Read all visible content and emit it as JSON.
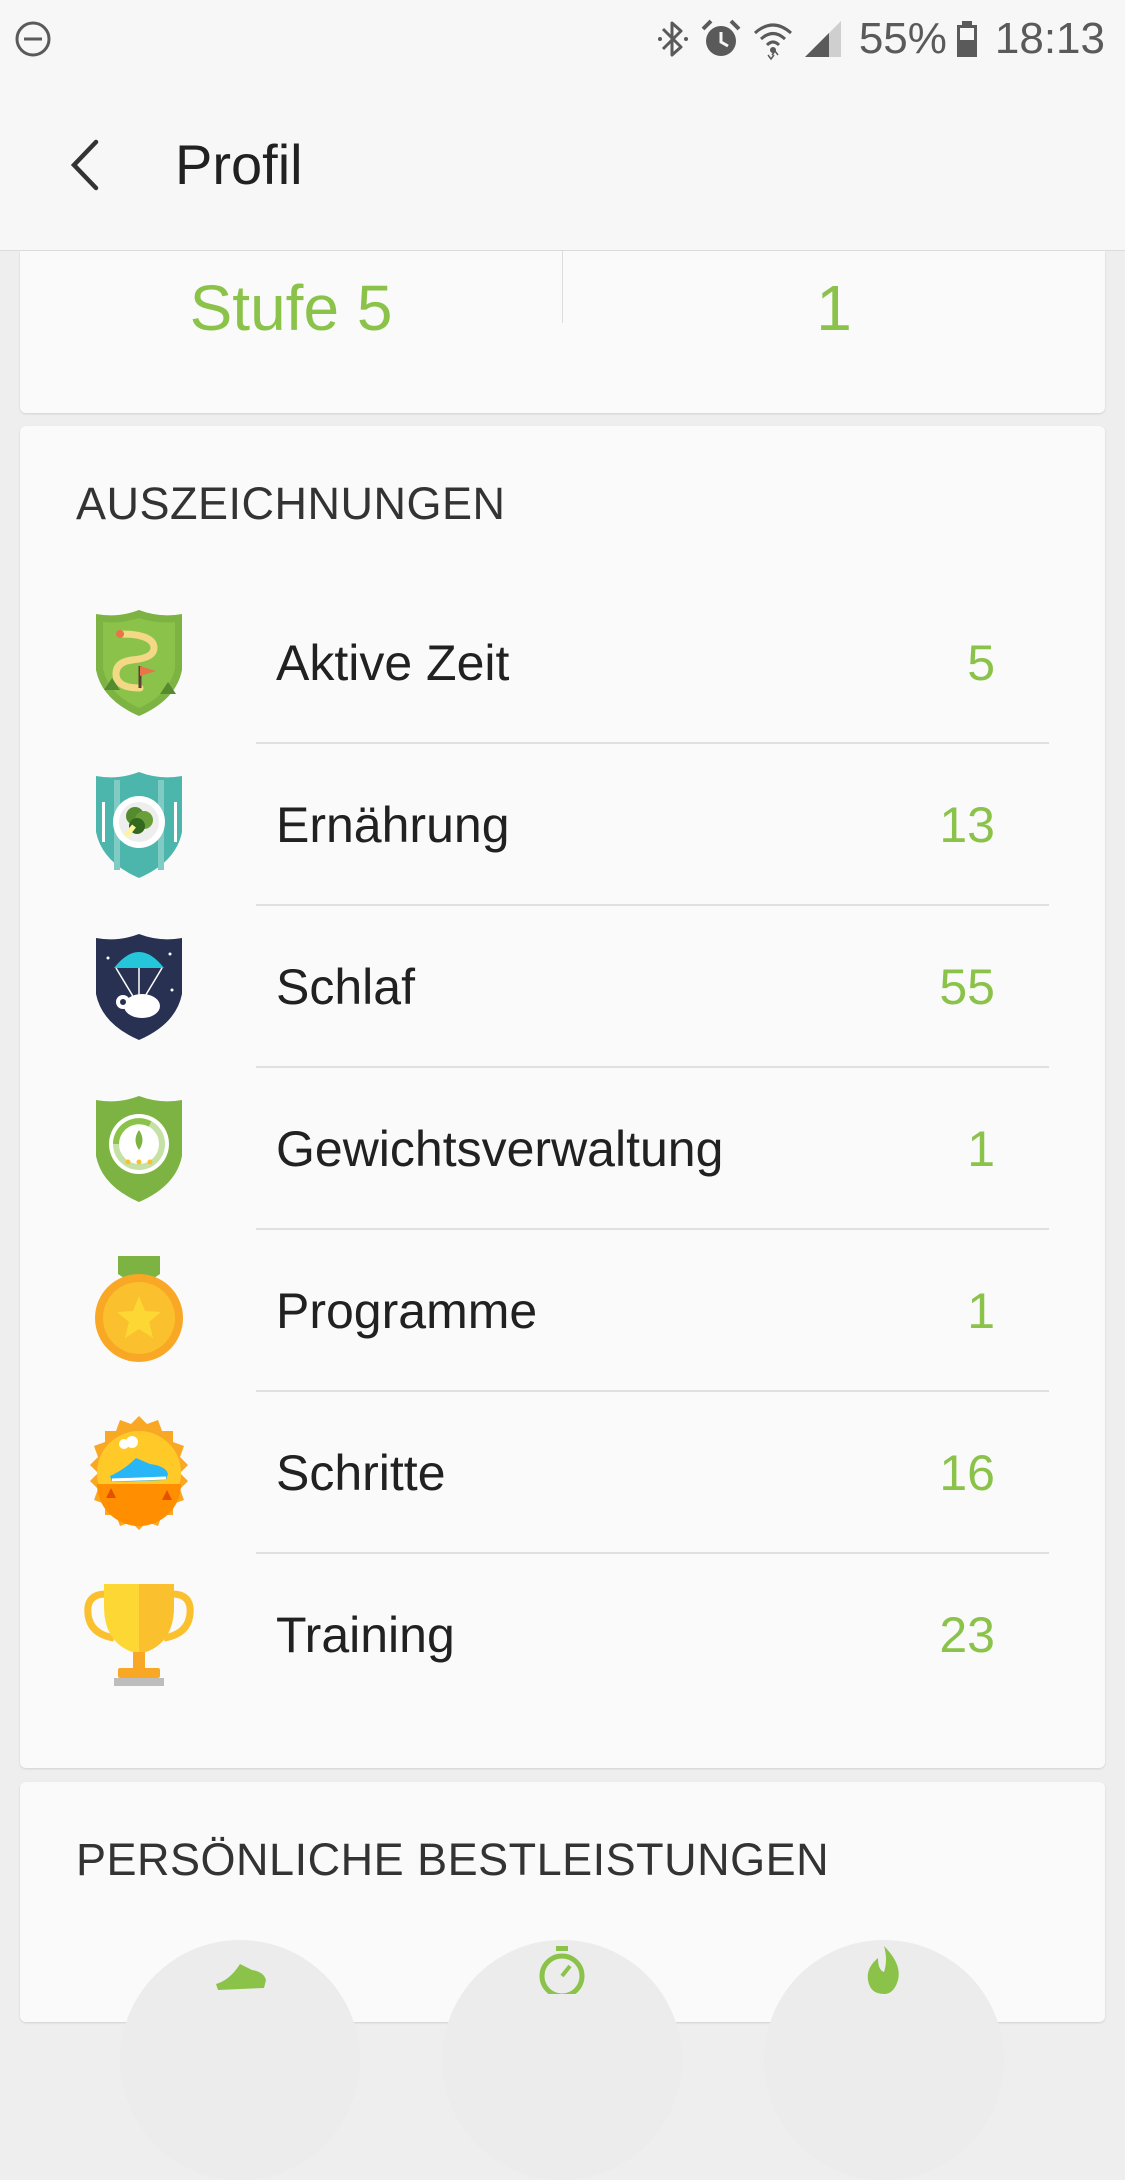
{
  "status_bar": {
    "battery": "55%",
    "time": "18:13",
    "icons": [
      "do-not-disturb-icon",
      "bluetooth-icon",
      "alarm-icon",
      "wifi-icon",
      "signal-icon",
      "battery-icon"
    ]
  },
  "header": {
    "title": "Profil",
    "back_icon": "arrow-back-icon"
  },
  "summary": {
    "level": "Stufe 5",
    "count": "1"
  },
  "awards": {
    "title": "AUSZEICHNUNGEN",
    "items": [
      {
        "label": "Aktive Zeit",
        "count": "5",
        "icon": "active-time-badge-icon"
      },
      {
        "label": "Ernährung",
        "count": "13",
        "icon": "nutrition-badge-icon"
      },
      {
        "label": "Schlaf",
        "count": "55",
        "icon": "sleep-badge-icon"
      },
      {
        "label": "Gewichtsverwaltung",
        "count": "1",
        "icon": "weight-badge-icon"
      },
      {
        "label": "Programme",
        "count": "1",
        "icon": "program-medal-icon"
      },
      {
        "label": "Schritte",
        "count": "16",
        "icon": "steps-badge-icon"
      },
      {
        "label": "Training",
        "count": "23",
        "icon": "training-trophy-icon"
      }
    ]
  },
  "personal_bests": {
    "title": "PERSÖNLICHE BESTLEISTUNGEN",
    "icons": [
      "shoe-icon",
      "stopwatch-icon",
      "flame-icon"
    ]
  },
  "colors": {
    "accent": "#8bc34a",
    "text": "#212121",
    "background": "#eeeeee",
    "card": "#fafafa"
  }
}
